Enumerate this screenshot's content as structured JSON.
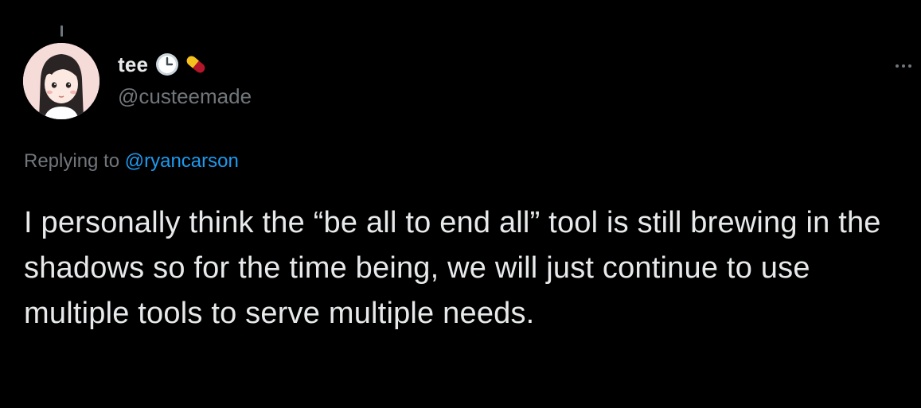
{
  "tweet": {
    "author": {
      "display_name": "tee",
      "handle": "@custeemade",
      "emojis": [
        "clock-emoji",
        "pill-emoji"
      ]
    },
    "reply": {
      "prefix": "Replying to",
      "target_handle": "@ryancarson"
    },
    "text": "I personally think the “be all to end all” tool is still brewing in the shadows so for the time being, we will just continue to use multiple tools to serve multiple needs.",
    "more_icon": "more-icon"
  },
  "colors": {
    "background": "#000000",
    "primary_text": "#e7e9ea",
    "secondary_text": "#71767b",
    "link": "#1d9bf0"
  }
}
